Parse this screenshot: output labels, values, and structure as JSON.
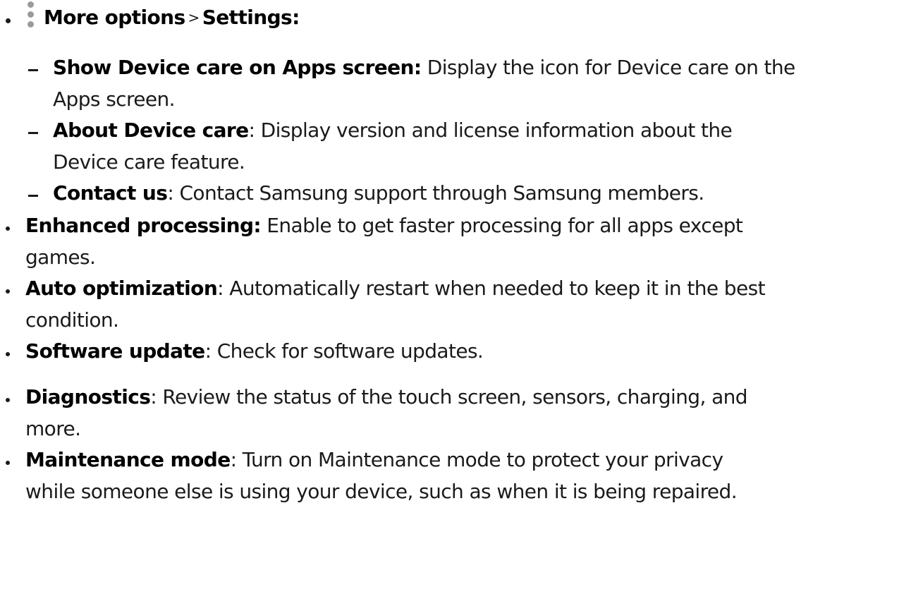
{
  "top_item": {
    "icon": "more-options-icon",
    "more_options_label": "More options",
    "separator": ">",
    "settings_label": "Settings:"
  },
  "sub_items": [
    {
      "term": "Show Device care on Apps screen:",
      "line1": " Display the icon for Device care on the",
      "line2": "Apps screen."
    },
    {
      "term": "About Device care",
      "line1": ": Display version and license information about the",
      "line2": "Device care feature."
    },
    {
      "term": "Contact us",
      "line1": ": Contact Samsung support through Samsung members.",
      "line2": ""
    }
  ],
  "items": [
    {
      "term": "Enhanced processing:",
      "line1": " Enable to get faster processing for all apps except",
      "line2": "games."
    },
    {
      "term": "Auto optimization",
      "line1": ": Automatically restart when needed to keep it in the best",
      "line2": "condition."
    },
    {
      "term": "Software update",
      "line1": ": Check for software updates.",
      "line2": ""
    },
    {
      "term": "Diagnostics",
      "line1": ": Review the status of the touch screen, sensors, charging, and",
      "line2": "more."
    },
    {
      "term": "Maintenance mode",
      "line1": ": Turn on Maintenance mode to protect your privacy",
      "line2": "while someone else is using your device, such as when it is being repaired."
    }
  ]
}
